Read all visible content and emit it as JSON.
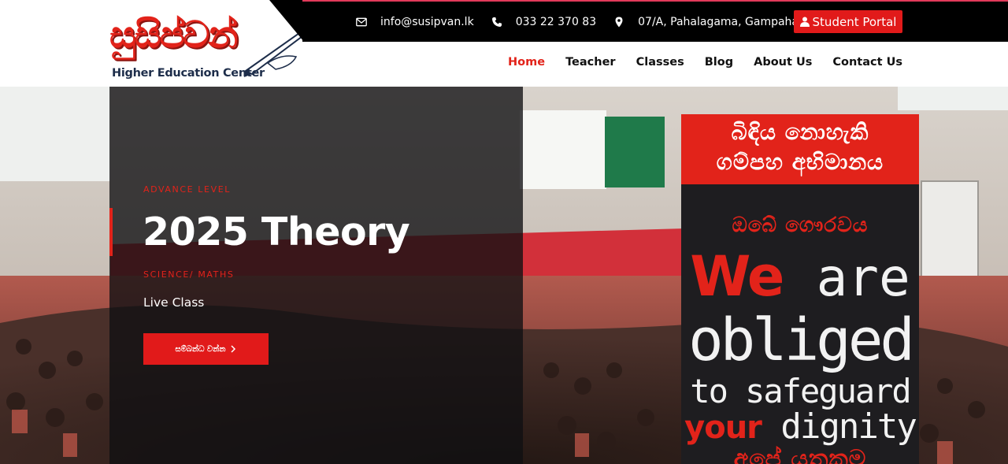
{
  "brand": {
    "logo_text": "සුසිප්වන්",
    "logo_subtitle": "Higher Education Center"
  },
  "topbar": {
    "email": "info@susipvan.lk",
    "phone": "033 22 370 83",
    "address": "07/A, Pahalagama, Gampaha",
    "portal_label": "Student Portal"
  },
  "nav": {
    "items": [
      {
        "label": "Home",
        "active": true
      },
      {
        "label": "Teacher",
        "active": false
      },
      {
        "label": "Classes",
        "active": false
      },
      {
        "label": "Blog",
        "active": false
      },
      {
        "label": "About Us",
        "active": false
      },
      {
        "label": "Contact Us",
        "active": false
      }
    ]
  },
  "hero": {
    "kicker": "ADVANCE LEVEL",
    "title": "2025 Theory",
    "subtitle": "SCIENCE/ MATHS",
    "live_label": "Live Class",
    "button_label": "සම්බන්ධ වන්න"
  },
  "banner": {
    "top_line1": "බිඳිය නොහැකි",
    "top_line2": "ගම්පහ අභිමානය",
    "si_line1": "ඔබේ ගෞරවය",
    "we": "We",
    "are": "are",
    "obliged": "obliged",
    "to_safeguard": "to safeguard",
    "your": "your",
    "dignity": "dignity",
    "si_line2": "අපේ යුතුකම"
  },
  "colors": {
    "accent": "#e2231a",
    "topbar_bg": "#000000",
    "nav_text": "#111111"
  },
  "icons": {
    "email": "envelope-icon",
    "phone": "phone-icon",
    "address": "map-marker-icon",
    "portal": "user-icon",
    "button": "chevron-right-icon"
  }
}
